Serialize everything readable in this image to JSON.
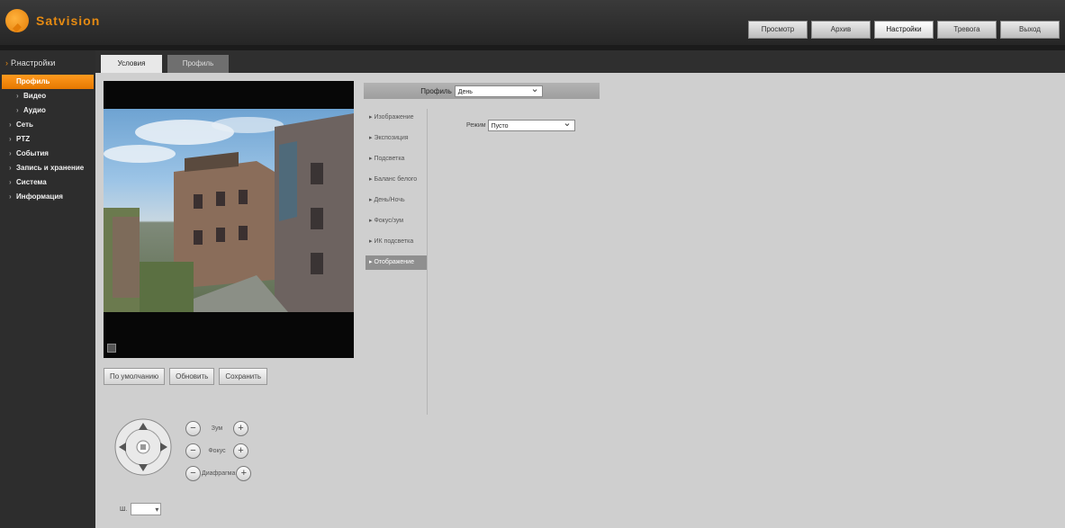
{
  "app": {
    "logo_text": "Satvision"
  },
  "topnav": [
    {
      "label": "Просмотр",
      "active": false
    },
    {
      "label": "Архив",
      "active": false
    },
    {
      "label": "Настройки",
      "active": true
    },
    {
      "label": "Тревога",
      "active": false
    },
    {
      "label": "Выход",
      "active": false
    }
  ],
  "sidebar": {
    "title": "Р.настройки",
    "items": [
      {
        "label": "Профиль",
        "active": true,
        "sub": true
      },
      {
        "label": "Видео",
        "active": false,
        "sub": true
      },
      {
        "label": "Аудио",
        "active": false,
        "sub": true
      },
      {
        "label": "Сеть",
        "active": false,
        "sub": false
      },
      {
        "label": "PTZ",
        "active": false,
        "sub": false
      },
      {
        "label": "События",
        "active": false,
        "sub": false
      },
      {
        "label": "Запись и хранение",
        "active": false,
        "sub": false
      },
      {
        "label": "Система",
        "active": false,
        "sub": false
      },
      {
        "label": "Информация",
        "active": false,
        "sub": false
      }
    ]
  },
  "tabs": [
    {
      "label": "Условия",
      "active": true
    },
    {
      "label": "Профиль",
      "active": false
    }
  ],
  "video_buttons": [
    "По умолчанию",
    "Обновить",
    "Сохранить"
  ],
  "ptz": {
    "zoom_label": "Зум",
    "focus_label": "Фокус",
    "aperture_label": "Диафрагма",
    "speed_label": "Ш.",
    "speed_value": ""
  },
  "profile_select": {
    "label": "Профиль",
    "value": "День"
  },
  "settings_menu": [
    {
      "label": "Изображение",
      "active": false
    },
    {
      "label": "Экспозиция",
      "active": false
    },
    {
      "label": "Подсветка",
      "active": false
    },
    {
      "label": "Баланс белого",
      "active": false
    },
    {
      "label": "День/Ночь",
      "active": false
    },
    {
      "label": "Фокус/зум",
      "active": false
    },
    {
      "label": "ИК подсветка",
      "active": false
    },
    {
      "label": "Отображение",
      "active": true
    }
  ],
  "mode_select": {
    "label": "Режим",
    "value": "Пусто"
  },
  "colors": {
    "accent": "#ff8c0f",
    "sidebar_bg": "#2d2d2d",
    "content_bg": "#cfcfcf"
  }
}
